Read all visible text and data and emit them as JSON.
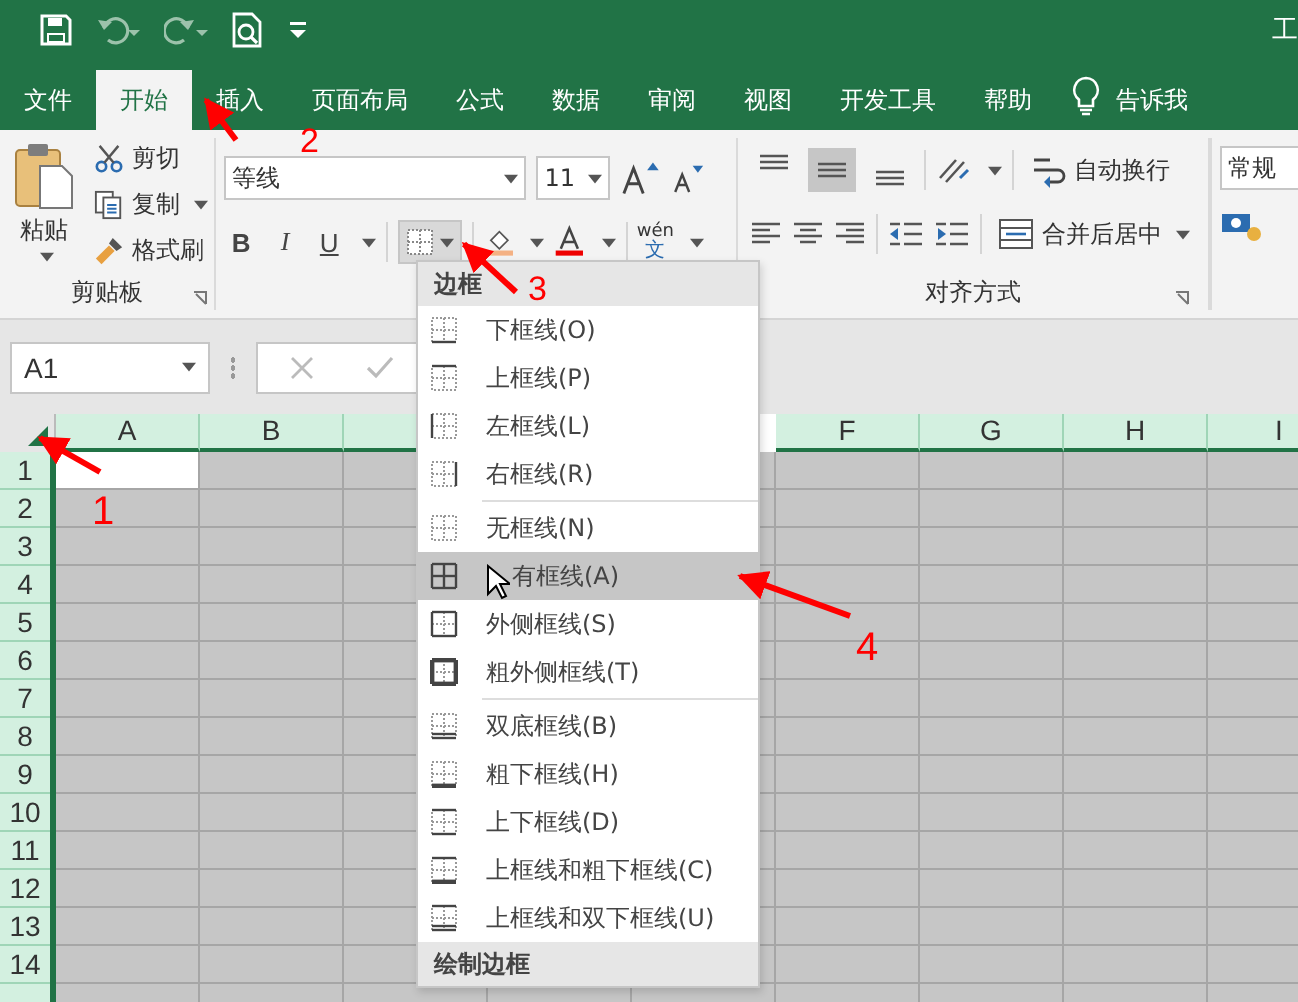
{
  "title_bar": {
    "title": "工"
  },
  "tabs": [
    {
      "label": "文件",
      "selected": false
    },
    {
      "label": "开始",
      "selected": true
    },
    {
      "label": "插入",
      "selected": false
    },
    {
      "label": "页面布局",
      "selected": false
    },
    {
      "label": "公式",
      "selected": false
    },
    {
      "label": "数据",
      "selected": false
    },
    {
      "label": "审阅",
      "selected": false
    },
    {
      "label": "视图",
      "selected": false
    },
    {
      "label": "开发工具",
      "selected": false
    },
    {
      "label": "帮助",
      "selected": false
    }
  ],
  "tell_me": "告诉我",
  "clipboard": {
    "paste": "粘贴",
    "cut": "剪切",
    "copy": "复制",
    "format_painter": "格式刷",
    "group_label": "剪贴板"
  },
  "font": {
    "name": "等线",
    "size": "11",
    "bold": "B",
    "italic": "I",
    "underline": "U",
    "phonetic_top": "wén",
    "phonetic_bottom": "文"
  },
  "alignment": {
    "vertical": [
      {
        "selected": false
      },
      {
        "selected": true
      },
      {
        "selected": false
      }
    ],
    "wrap": "自动换行",
    "merge": "合并后居中",
    "group_label": "对齐方式"
  },
  "number": {
    "format": "常规"
  },
  "formula_bar": {
    "name_box": "A1"
  },
  "sheet": {
    "columns": [
      "A",
      "B",
      "F",
      "G",
      "H",
      "I"
    ],
    "rows": [
      "1",
      "2",
      "3",
      "4",
      "5",
      "6",
      "7",
      "8",
      "9",
      "10",
      "11",
      "12",
      "13",
      "14"
    ]
  },
  "border_menu": {
    "header": "边框",
    "items": [
      {
        "label": "下框线(O)",
        "kind": "bottom",
        "selected": false
      },
      {
        "label": "上框线(P)",
        "kind": "top",
        "selected": false
      },
      {
        "label": "左框线(L)",
        "kind": "left",
        "selected": false
      },
      {
        "label": "右框线(R)",
        "kind": "right",
        "selected": false
      },
      {
        "label": "无框线(N)",
        "kind": "none",
        "selected": false
      },
      {
        "label": "有框线(A)",
        "kind": "all",
        "selected": true
      },
      {
        "label": "外侧框线(S)",
        "kind": "outside",
        "selected": false
      },
      {
        "label": "粗外侧框线(T)",
        "kind": "thick_outside",
        "selected": false
      },
      {
        "label": "双底框线(B)",
        "kind": "double_bottom",
        "selected": false
      },
      {
        "label": "粗下框线(H)",
        "kind": "thick_bottom",
        "selected": false
      },
      {
        "label": "上下框线(D)",
        "kind": "top_bottom",
        "selected": false
      },
      {
        "label": "上框线和粗下框线(C)",
        "kind": "top_thick_bottom",
        "selected": false
      },
      {
        "label": "上框线和双下框线(U)",
        "kind": "top_double_bottom",
        "selected": false
      }
    ],
    "draw_header": "绘制边框"
  },
  "annotations": [
    {
      "label": "1"
    },
    {
      "label": "2"
    },
    {
      "label": "3"
    },
    {
      "label": "4"
    }
  ]
}
